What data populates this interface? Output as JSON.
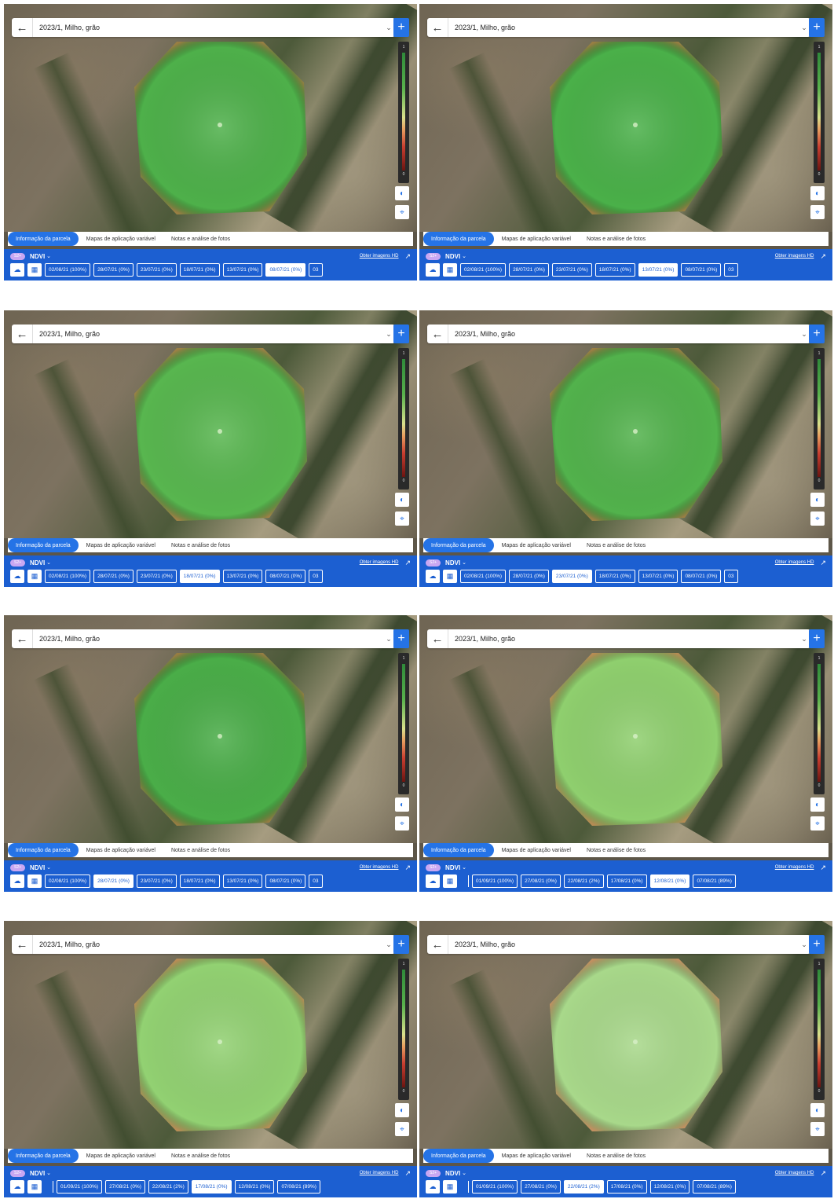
{
  "header": {
    "field_name": "2023/1, Milho, grão"
  },
  "legend": {
    "max_label": "1",
    "min_label": "0"
  },
  "tabs": [
    "Informação da parcela",
    "Mapas de aplicação variável",
    "Notas e análise de fotos"
  ],
  "index": {
    "badge": "S2+",
    "name": "NDVI"
  },
  "hd_link": "Obter imagens HD",
  "colors": {
    "accent": "#2573e6",
    "bar": "#1c5fd1"
  },
  "panels": [
    {
      "field_color": "#4eb04a",
      "dates": [
        "02/08/21 (100%)",
        "28/07/21 (0%)",
        "23/07/21 (0%)",
        "18/07/21 (0%)",
        "13/07/21 (0%)",
        "08/07/21 (0%)",
        "03"
      ],
      "selected": 5,
      "spacer": false
    },
    {
      "field_color": "#4ab049",
      "dates": [
        "02/08/21 (100%)",
        "28/07/21 (0%)",
        "23/07/21 (0%)",
        "18/07/21 (0%)",
        "13/07/21 (0%)",
        "08/07/21 (0%)",
        "03"
      ],
      "selected": 4,
      "spacer": false
    },
    {
      "field_color": "#58b64f",
      "dates": [
        "02/08/21 (100%)",
        "28/07/21 (0%)",
        "23/07/21 (0%)",
        "18/07/21 (0%)",
        "13/07/21 (0%)",
        "08/07/21 (0%)",
        "03"
      ],
      "selected": 3,
      "spacer": false
    },
    {
      "field_color": "#52b24c",
      "dates": [
        "02/08/21 (100%)",
        "28/07/21 (0%)",
        "23/07/21 (0%)",
        "18/07/21 (0%)",
        "13/07/21 (0%)",
        "08/07/21 (0%)",
        "03"
      ],
      "selected": 2,
      "spacer": false
    },
    {
      "field_color": "#4aad48",
      "dates": [
        "02/08/21 (100%)",
        "28/07/21 (0%)",
        "23/07/21 (0%)",
        "18/07/21 (0%)",
        "13/07/21 (0%)",
        "08/07/21 (0%)",
        "03"
      ],
      "selected": 1,
      "spacer": false
    },
    {
      "field_color": "#8fcf6e",
      "dates": [
        "01/09/21 (100%)",
        "27/08/21 (0%)",
        "22/08/21 (2%)",
        "17/08/21 (0%)",
        "12/08/21 (0%)",
        "07/08/21 (89%)"
      ],
      "selected": 4,
      "spacer": true
    },
    {
      "field_color": "#92d172",
      "dates": [
        "01/09/21 (100%)",
        "27/08/21 (0%)",
        "22/08/21 (2%)",
        "17/08/21 (0%)",
        "12/08/21 (0%)",
        "07/08/21 (89%)"
      ],
      "selected": 3,
      "spacer": true
    },
    {
      "field_color": "#a8d88a",
      "dates": [
        "01/09/21 (100%)",
        "27/08/21 (0%)",
        "22/08/21 (2%)",
        "17/08/21 (0%)",
        "12/08/21 (0%)",
        "07/08/21 (89%)"
      ],
      "selected": 2,
      "spacer": true
    }
  ]
}
